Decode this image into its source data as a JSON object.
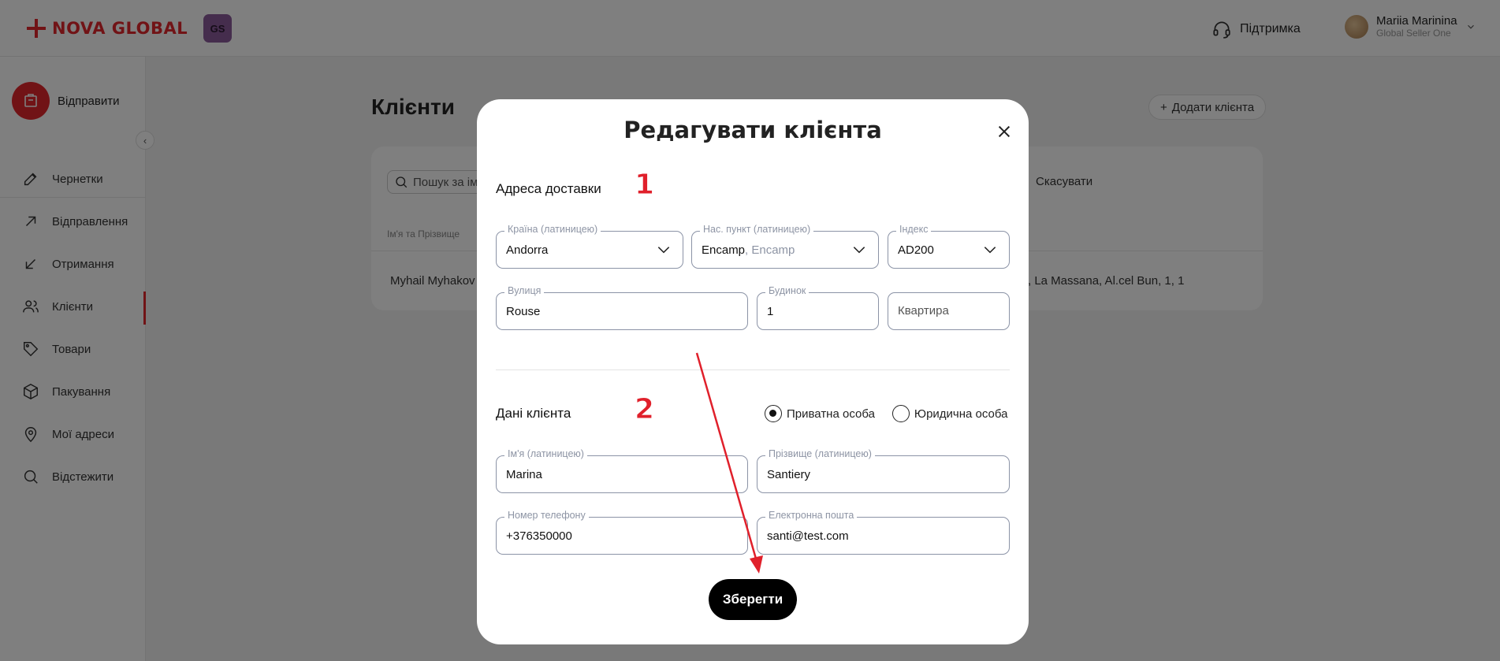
{
  "header": {
    "logo_text": "NOVA GLOBAL",
    "badge": "GS",
    "support_label": "Підтримка",
    "user_name": "Mariia Marinina",
    "user_sub": "Global Seller One"
  },
  "sidebar": {
    "send_label": "Відправити",
    "items": [
      {
        "label": "Чернетки",
        "icon": "edit-icon"
      },
      {
        "label": "Відправлення",
        "icon": "arrow-up-right-icon"
      },
      {
        "label": "Отримання",
        "icon": "arrow-down-left-icon"
      },
      {
        "label": "Клієнти",
        "icon": "users-icon",
        "active": true
      },
      {
        "label": "Товари",
        "icon": "tag-icon"
      },
      {
        "label": "Пакування",
        "icon": "box-icon"
      },
      {
        "label": "Мої адреси",
        "icon": "map-pin-icon"
      },
      {
        "label": "Відстежити",
        "icon": "search-icon"
      }
    ]
  },
  "page": {
    "title": "Клієнти",
    "add_client": "Додати клієнта",
    "search_placeholder": "Пошук за ім",
    "cancel": "Скасувати",
    "column_name": "Ім'я та Прізвище",
    "row_name": "Myhail Myhakov",
    "row_address": ", La Massana, Al.cel Bun, 1, 1"
  },
  "modal": {
    "title": "Редагувати клієнта",
    "delivery": {
      "section_title": "Адреса доставки",
      "marker": "1",
      "country": {
        "label": "Країна (латиницею)",
        "value": "Andorra"
      },
      "city": {
        "label": "Нас. пункт (латиницею)",
        "value": "Encamp",
        "hint": ", Encamp"
      },
      "index": {
        "label": "Індекс",
        "value": "AD200"
      },
      "street": {
        "label": "Вулиця",
        "value": "Rouse"
      },
      "house": {
        "label": "Будинок",
        "value": "1"
      },
      "apartment": {
        "placeholder": "Квартира"
      }
    },
    "client": {
      "section_title": "Дані клієнта",
      "marker": "2",
      "type_private": "Приватна особа",
      "type_legal": "Юридична особа",
      "selected_type": "private",
      "first_name": {
        "label": "Ім'я (латиницею)",
        "value": "Marina"
      },
      "last_name": {
        "label": "Прізвище (латиницею)",
        "value": "Santiery"
      },
      "phone": {
        "label": "Номер телефону",
        "value": "+376350000"
      },
      "email": {
        "label": "Електронна пошта",
        "value": "santi@test.com"
      }
    },
    "save_label": "Зберегти"
  },
  "colors": {
    "brand": "#e3262d",
    "annotation": "#e0202b",
    "field_border": "#8b93a6"
  }
}
